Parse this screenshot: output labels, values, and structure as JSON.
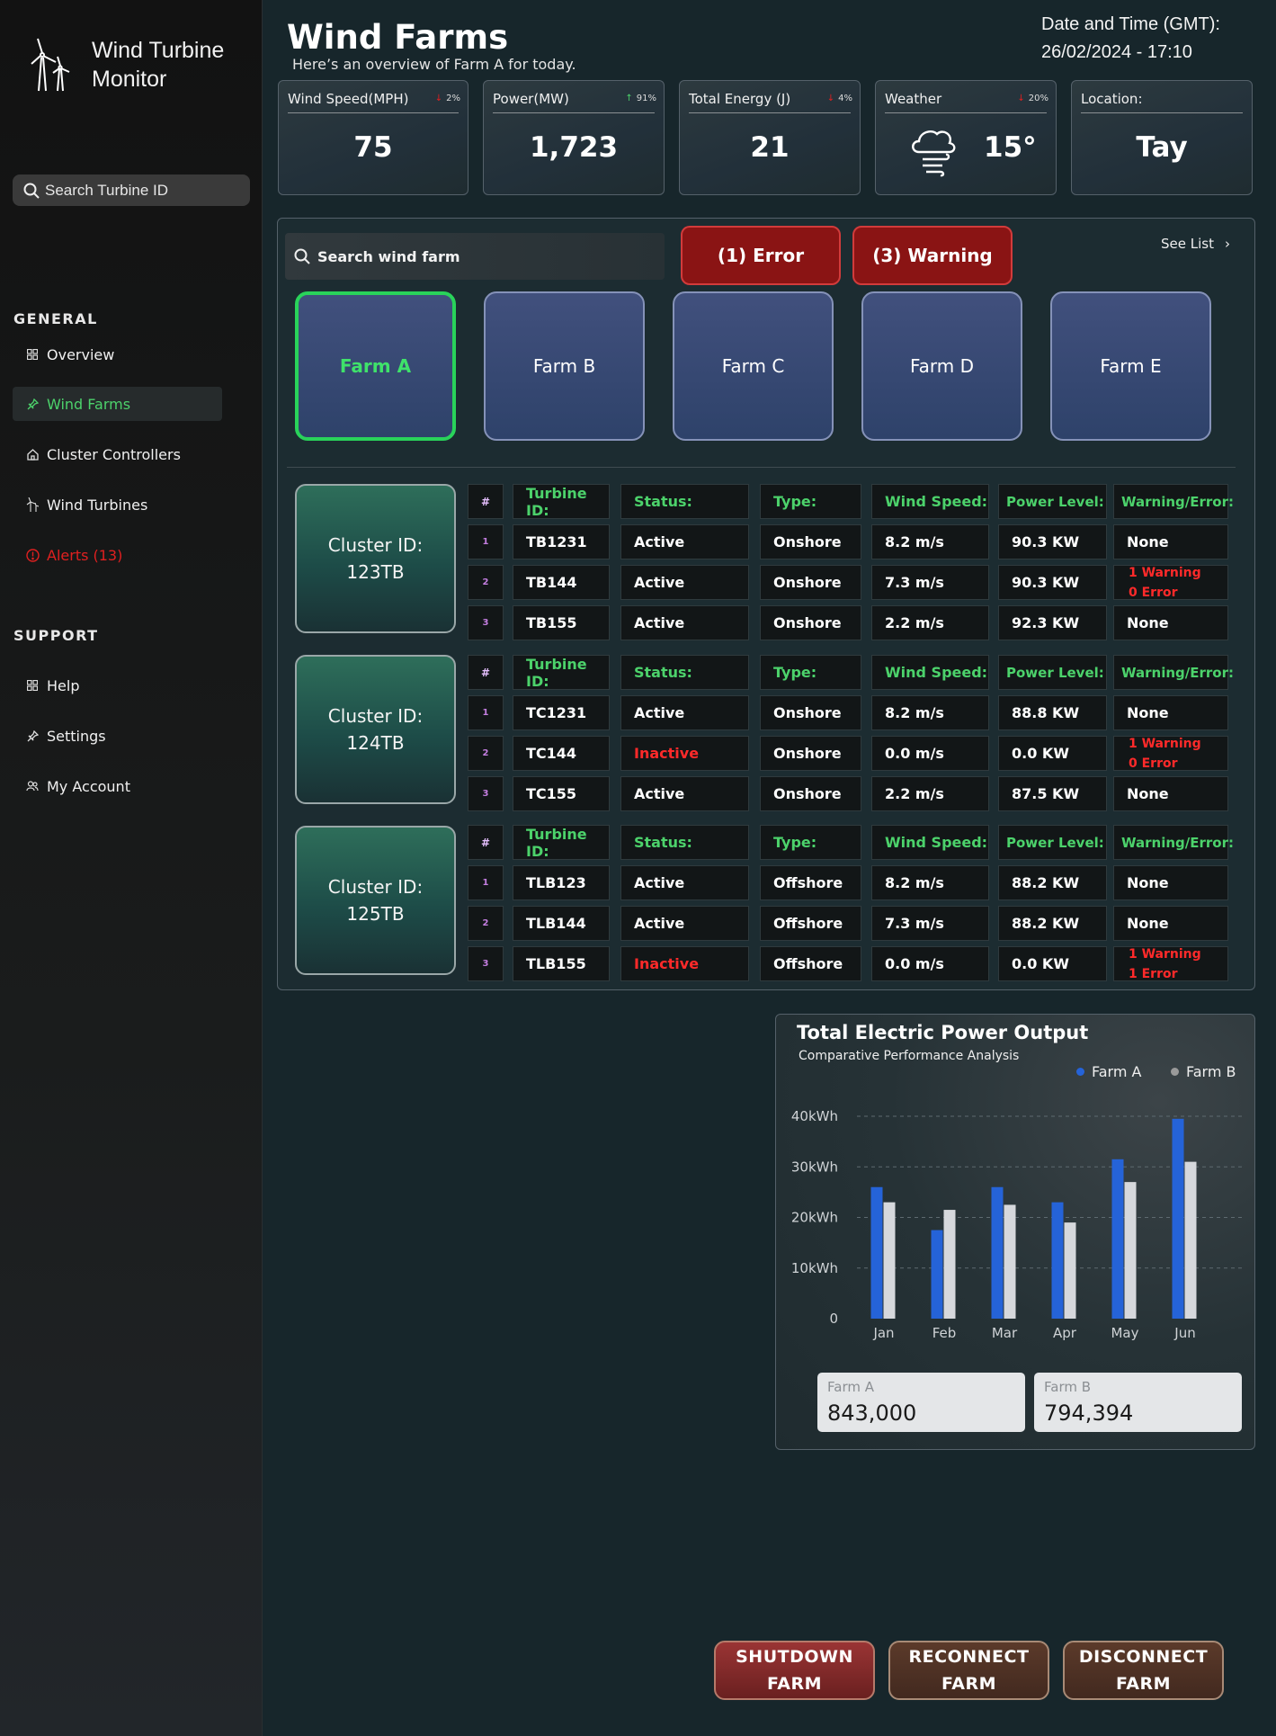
{
  "app": {
    "title_line1": "Wind Turbine",
    "title_line2": "Monitor"
  },
  "sidebar": {
    "search_placeholder": "Search Turbine ID",
    "general_label": "GENERAL",
    "support_label": "SUPPORT",
    "general_items": [
      {
        "label": "Overview",
        "icon": "grid-icon"
      },
      {
        "label": "Wind Farms",
        "icon": "pin-icon",
        "active": true
      },
      {
        "label": "Cluster Controllers",
        "icon": "home-icon"
      },
      {
        "label": "Wind Turbines",
        "icon": "turbine-icon"
      },
      {
        "label": "Alerts (13)",
        "icon": "alert-icon"
      }
    ],
    "support_items": [
      {
        "label": "Help",
        "icon": "grid-icon"
      },
      {
        "label": "Settings",
        "icon": "pin-icon"
      },
      {
        "label": "My Account",
        "icon": "users-icon"
      }
    ]
  },
  "header": {
    "title": "Wind Farms",
    "subtitle": "Here’s an overview of Farm A for today.",
    "datetime_label": "Date and Time (GMT):",
    "datetime_value": "26/02/2024 - 17:10"
  },
  "stats": [
    {
      "label": "Wind Speed(MPH)",
      "change": "2%",
      "direction": "down",
      "value": "75"
    },
    {
      "label": "Power(MW)",
      "change": "91%",
      "direction": "up",
      "value": "1,723"
    },
    {
      "label": "Total Energy (J)",
      "change": "4%",
      "direction": "down",
      "value": "21"
    },
    {
      "label": "Weather",
      "change": "20%",
      "direction": "down",
      "value": "15°"
    },
    {
      "label": "Location:",
      "value": "Tay"
    }
  ],
  "farms_panel": {
    "search_placeholder": "Search wind farm",
    "error_button": "(1) Error",
    "warning_button": "(3) Warning",
    "see_list": "See List",
    "farms": [
      "Farm A",
      "Farm B",
      "Farm C",
      "Farm D",
      "Farm E"
    ],
    "selected_farm": "Farm A"
  },
  "table_headers": {
    "num": "#",
    "turbine_id": "Turbine ID:",
    "status": "Status:",
    "type": "Type:",
    "wind_speed": "Wind Speed:",
    "power_level": "Power Level:",
    "warning_error": "Warning/Error:"
  },
  "clusters": [
    {
      "label_line1": "Cluster ID:",
      "label_line2": "123TB",
      "rows": [
        {
          "num": "1",
          "id": "TB1231",
          "status": "Active",
          "type": "Onshore",
          "wind": "8.2 m/s",
          "power": "90.3 KW",
          "warn": "None"
        },
        {
          "num": "2",
          "id": "TB144",
          "status": "Active",
          "type": "Onshore",
          "wind": "7.3 m/s",
          "power": "90.3 KW",
          "warn_line1": "1 Warning",
          "warn_line2": "0 Error"
        },
        {
          "num": "3",
          "id": "TB155",
          "status": "Active",
          "type": "Onshore",
          "wind": "2.2 m/s",
          "power": "92.3 KW",
          "warn": "None"
        }
      ]
    },
    {
      "label_line1": "Cluster ID:",
      "label_line2": "124TB",
      "rows": [
        {
          "num": "1",
          "id": "TC1231",
          "status": "Active",
          "type": "Onshore",
          "wind": "8.2 m/s",
          "power": "88.8 KW",
          "warn": "None"
        },
        {
          "num": "2",
          "id": "TC144",
          "status": "Inactive",
          "type": "Onshore",
          "wind": "0.0 m/s",
          "power": "0.0 KW",
          "warn_line1": "1 Warning",
          "warn_line2": "0 Error"
        },
        {
          "num": "3",
          "id": "TC155",
          "status": "Active",
          "type": "Onshore",
          "wind": "2.2 m/s",
          "power": "87.5 KW",
          "warn": "None"
        }
      ]
    },
    {
      "label_line1": "Cluster ID:",
      "label_line2": "125TB",
      "rows": [
        {
          "num": "1",
          "id": "TLB123",
          "status": "Active",
          "type": "Offshore",
          "wind": "8.2 m/s",
          "power": "88.2 KW",
          "warn": "None"
        },
        {
          "num": "2",
          "id": "TLB144",
          "status": "Active",
          "type": "Offshore",
          "wind": "7.3 m/s",
          "power": "88.2 KW",
          "warn": "None"
        },
        {
          "num": "3",
          "id": "TLB155",
          "status": "Inactive",
          "type": "Offshore",
          "wind": "0.0 m/s",
          "power": "0.0 KW",
          "warn_line1": "1 Warning",
          "warn_line2": "1 Error"
        }
      ]
    }
  ],
  "chart_card": {
    "title": "Total Electric Power Output",
    "subtitle": "Comparative Performance Analysis",
    "totals": [
      {
        "label": "Farm A",
        "value": "843,000"
      },
      {
        "label": "Farm B",
        "value": "794,394"
      }
    ]
  },
  "chart_data": {
    "type": "bar",
    "title": "Total Electric Power Output",
    "subtitle": "Comparative Performance Analysis",
    "categories": [
      "Jan",
      "Feb",
      "Mar",
      "Apr",
      "May",
      "Jun"
    ],
    "series": [
      {
        "name": "Farm A",
        "color": "#2563d8",
        "values": [
          26,
          17.5,
          26,
          23,
          31.5,
          39.5
        ]
      },
      {
        "name": "Farm B",
        "color": "#d6d8dc",
        "values": [
          23,
          21.5,
          22.5,
          19,
          27,
          31
        ]
      }
    ],
    "yticks": [
      "0",
      "10kWh",
      "20kWh",
      "30kWh",
      "40kWh"
    ],
    "ylim": [
      0,
      40
    ],
    "grid": true,
    "legend": "top-right"
  },
  "actions": {
    "shutdown": [
      "SHUTDOWN",
      "FARM"
    ],
    "reconnect": [
      "RECONNECT",
      "FARM"
    ],
    "disconnect": [
      "DISCONNECT",
      "FARM"
    ]
  },
  "colors": {
    "accent_green": "#4cd26b",
    "error_red": "#ff2a2a",
    "farm_a_blue": "#2563d8",
    "farm_b_gray": "#d6d8dc"
  }
}
